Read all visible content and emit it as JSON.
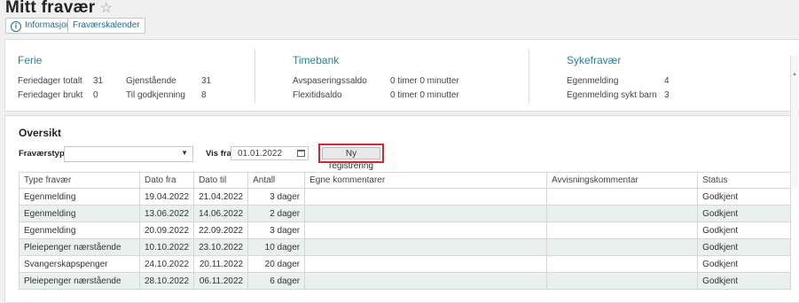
{
  "page": {
    "title": "Mitt fravær"
  },
  "toolbar": {
    "info_label": "Informasjon",
    "calendar_label": "Fraværskalender"
  },
  "summary": {
    "ferie": {
      "title": "Ferie",
      "rows": [
        {
          "label": "Feriedager totalt",
          "value": "31",
          "label2": "Gjenstående",
          "value2": "31"
        },
        {
          "label": "Feriedager brukt",
          "value": "0",
          "label2": "Til godkjenning",
          "value2": "8"
        }
      ]
    },
    "timebank": {
      "title": "Timebank",
      "rows": [
        {
          "label": "Avspaseringssaldo",
          "value": "0 timer 0 minutter"
        },
        {
          "label": "Flexitidsaldo",
          "value": "0 timer 0 minutter"
        }
      ]
    },
    "sykefravaer": {
      "title": "Sykefravær",
      "rows": [
        {
          "label": "Egenmelding",
          "value": "4"
        },
        {
          "label": "Egenmelding sykt barn",
          "value": "3"
        }
      ]
    }
  },
  "oversikt": {
    "title": "Oversikt",
    "filter_type_label": "Fraværstype:",
    "filter_type_value": "",
    "vis_fra_label": "Vis fra:",
    "vis_fra_value": "01.01.2022",
    "new_button_label": "Ny registrering",
    "highlight_color": "#d7262b",
    "columns": [
      "Type fravær",
      "Dato fra",
      "Dato til",
      "Antall",
      "Egne kommentarer",
      "Avvisningskommentar",
      "Status"
    ],
    "rows": [
      [
        "Egenmelding",
        "19.04.2022",
        "21.04.2022",
        "3 dager",
        "",
        "",
        "Godkjent"
      ],
      [
        "Egenmelding",
        "13.06.2022",
        "14.06.2022",
        "2 dager",
        "",
        "",
        "Godkjent"
      ],
      [
        "Egenmelding",
        "20.09.2022",
        "22.09.2022",
        "3 dager",
        "",
        "",
        "Godkjent"
      ],
      [
        "Pleiepenger nærstående",
        "10.10.2022",
        "23.10.2022",
        "10 dager",
        "",
        "",
        "Godkjent"
      ],
      [
        "Svangerskapspenger",
        "24.10.2022",
        "20.11.2022",
        "20 dager",
        "",
        "",
        "Godkjent"
      ],
      [
        "Pleiepenger nærstående",
        "28.10.2022",
        "06.11.2022",
        "6 dager",
        "",
        "",
        "Godkjent"
      ]
    ]
  }
}
